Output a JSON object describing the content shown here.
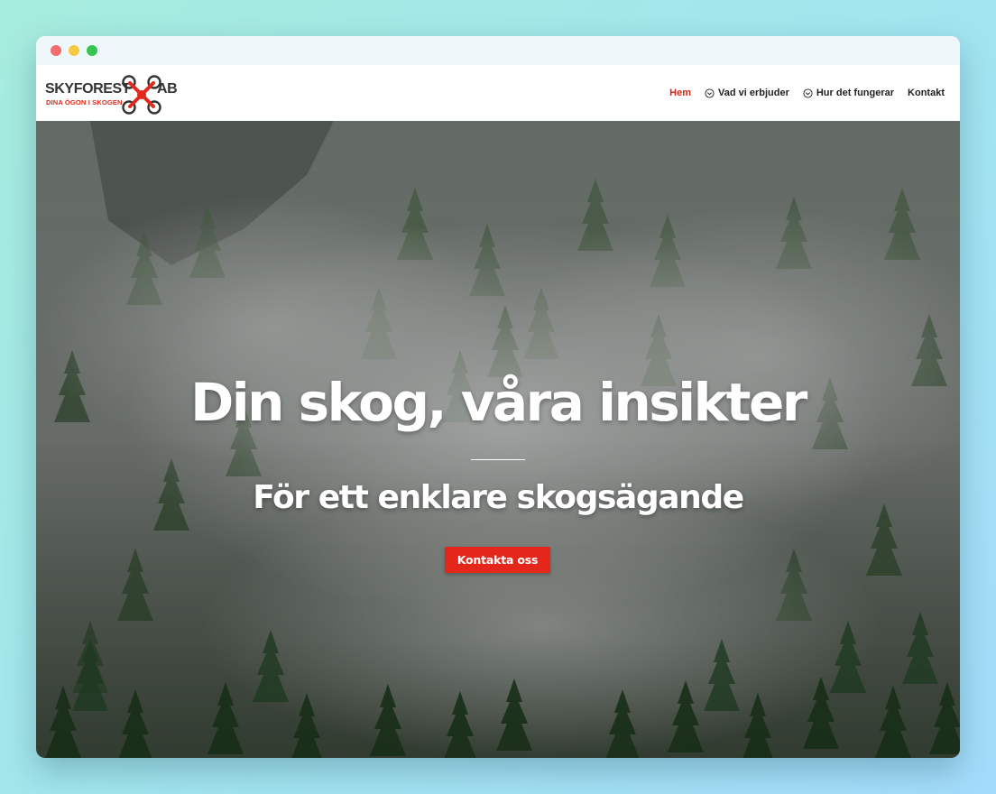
{
  "window": {
    "controls": {
      "close_color": "#f26d6a",
      "minimize_color": "#f7c844",
      "maximize_color": "#34c650"
    }
  },
  "logo": {
    "brand": "SKYFOREST",
    "suffix": "AB",
    "tagline": "DINA ÖGON I SKOGEN",
    "accent_color": "#e02a1c",
    "icon": "drone-icon"
  },
  "nav": {
    "items": [
      {
        "label": "Hem",
        "active": true,
        "icon": null
      },
      {
        "label": "Vad vi erbjuder",
        "active": false,
        "icon": "chevron-down-circle-icon"
      },
      {
        "label": "Hur det fungerar",
        "active": false,
        "icon": "chevron-down-circle-icon"
      },
      {
        "label": "Kontakt",
        "active": false,
        "icon": null
      }
    ],
    "active_color": "#d8261b"
  },
  "hero": {
    "title": "Din skog, våra insikter",
    "subtitle": "För ett enklare skogsägande",
    "cta_label": "Kontakta oss",
    "cta_color": "#e5261a"
  }
}
